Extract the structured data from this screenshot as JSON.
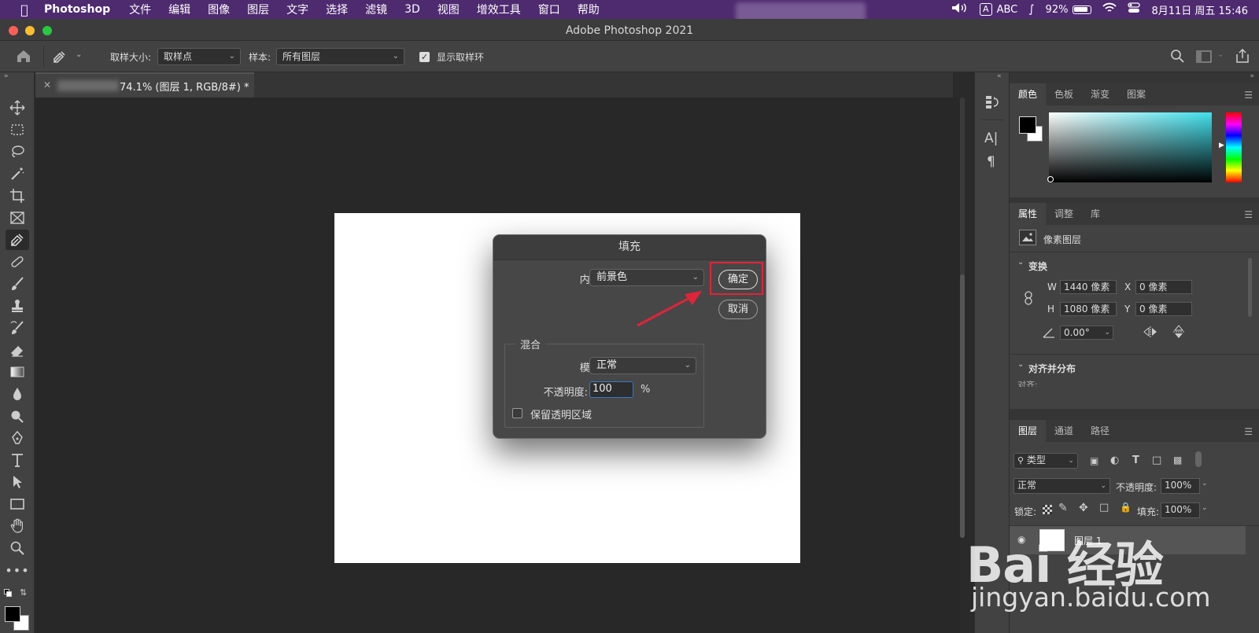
{
  "menubar": {
    "app": "Photoshop",
    "menus": [
      "文件",
      "编辑",
      "图像",
      "图层",
      "文字",
      "选择",
      "滤镜",
      "3D",
      "视图",
      "增效工具",
      "窗口",
      "帮助"
    ],
    "input_source_letter": "A",
    "input_source": "ABC",
    "battery": "92%",
    "datetime": "8月11日 周五  15:46"
  },
  "window": {
    "title": "Adobe Photoshop 2021"
  },
  "options": {
    "sample_size_label": "取样大小:",
    "sample_size_value": "取样点",
    "sample_label": "样本:",
    "sample_value": "所有图层",
    "show_ring_label": "显示取样环"
  },
  "document": {
    "tab_title": "74.1% (图层 1, RGB/8#) *"
  },
  "dialog": {
    "title": "填充",
    "content_label": "内容:",
    "content_value": "前景色",
    "ok": "确定",
    "cancel": "取消",
    "blend_group": "混合",
    "mode_label": "模式:",
    "mode_value": "正常",
    "opacity_label": "不透明度:",
    "opacity_value": "100",
    "opacity_unit": "%",
    "preserve_label": "保留透明区域"
  },
  "color_panel": {
    "tabs": [
      "颜色",
      "色板",
      "渐变",
      "图案"
    ],
    "foreground": "#000000",
    "background": "#ffffff",
    "hue_color": "#40e0ec"
  },
  "props_panel": {
    "tabs": [
      "属性",
      "调整",
      "库"
    ],
    "layer_type": "像素图层",
    "transform_section": "变换",
    "w_label": "W",
    "w_value": "1440 像素",
    "h_label": "H",
    "h_value": "1080 像素",
    "x_label": "X",
    "x_value": "0 像素",
    "y_label": "Y",
    "y_value": "0 像素",
    "angle_value": "0.00°",
    "align_section": "对齐并分布",
    "align_sub": "对齐:"
  },
  "layers_panel": {
    "tabs": [
      "图层",
      "通道",
      "路径"
    ],
    "filter_kind": "类型",
    "blend_mode": "正常",
    "opacity_label": "不透明度:",
    "opacity_value": "100%",
    "lock_label": "锁定:",
    "fill_label": "填充:",
    "fill_value": "100%",
    "layer_name": "图层 1"
  },
  "watermark": {
    "brand": "Bai 经验",
    "url": "jingyan.baidu.com"
  }
}
